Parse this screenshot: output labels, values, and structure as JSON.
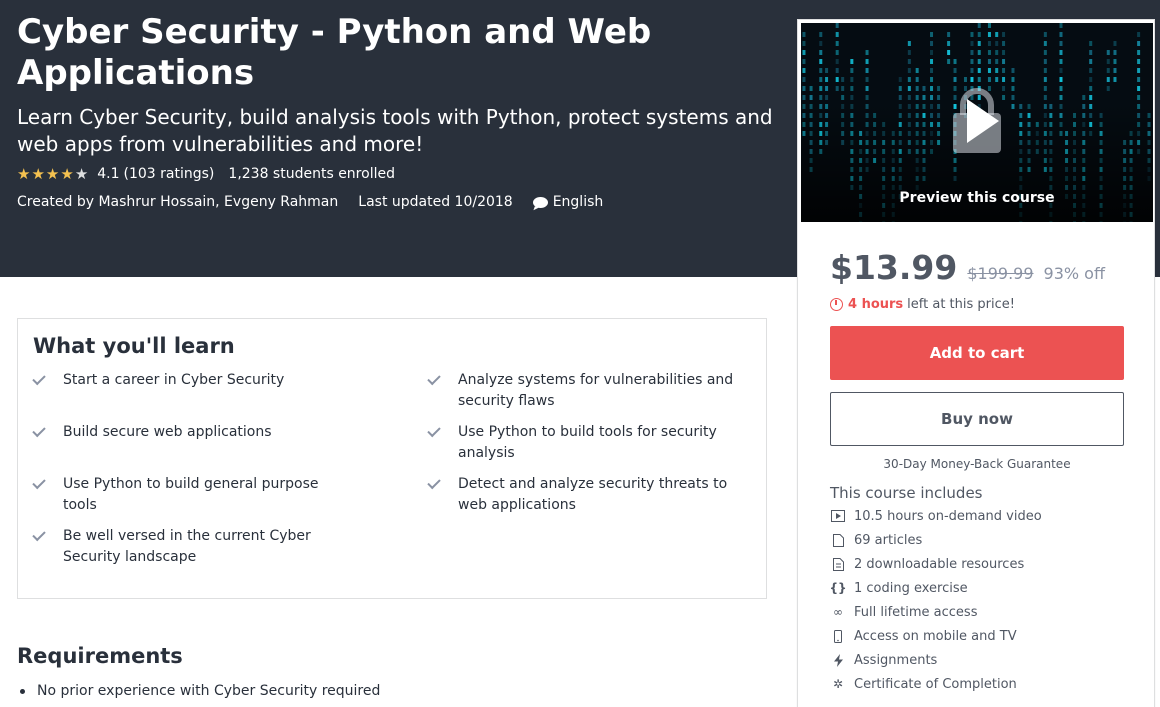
{
  "course": {
    "title": "Cyber Security - Python and Web Applications",
    "subtitle": "Learn Cyber Security, build analysis tools with Python, protect systems and web apps from vulnerabilities and more!",
    "rating_value": "4.1",
    "rating_count": "(103 ratings)",
    "rating_stars": 4.1,
    "students": "1,238 students enrolled",
    "created_by": "Created by Mashrur Hossain, Evgeny Rahman",
    "last_updated": "Last updated 10/2018",
    "language": "English"
  },
  "learn": {
    "heading": "What you'll learn",
    "items": [
      "Start a career in Cyber Security",
      "Analyze systems for vulnerabilities and security flaws",
      "Build secure web applications",
      "Use Python to build tools for security analysis",
      "Use Python to build general purpose tools",
      "Detect and analyze security threats to web applications",
      "Be well versed in the current Cyber Security landscape"
    ]
  },
  "requirements": {
    "heading": "Requirements",
    "items": [
      "No prior experience with Cyber Security required"
    ]
  },
  "sidebar": {
    "preview_label": "Preview this course",
    "price": "$13.99",
    "original_price": "$199.99",
    "discount": "93% off",
    "timer_bold": "4 hours",
    "timer_rest": "left at this price!",
    "add_to_cart": "Add to cart",
    "buy_now": "Buy now",
    "guarantee": "30-Day Money-Back Guarantee",
    "includes_heading": "This course includes",
    "includes": [
      {
        "icon": "video-icon",
        "label": "10.5 hours on-demand video"
      },
      {
        "icon": "article-icon",
        "label": "69 articles"
      },
      {
        "icon": "download-icon",
        "label": "2 downloadable resources"
      },
      {
        "icon": "code-icon",
        "label": "1 coding exercise"
      },
      {
        "icon": "infinity-icon",
        "label": "Full lifetime access"
      },
      {
        "icon": "mobile-icon",
        "label": "Access on mobile and TV"
      },
      {
        "icon": "lightning-icon",
        "label": "Assignments"
      },
      {
        "icon": "certificate-icon",
        "label": "Certificate of Completion"
      }
    ]
  },
  "colors": {
    "hero_bg": "#29303b",
    "accent_red": "#ec5252",
    "star": "#f4c150"
  }
}
